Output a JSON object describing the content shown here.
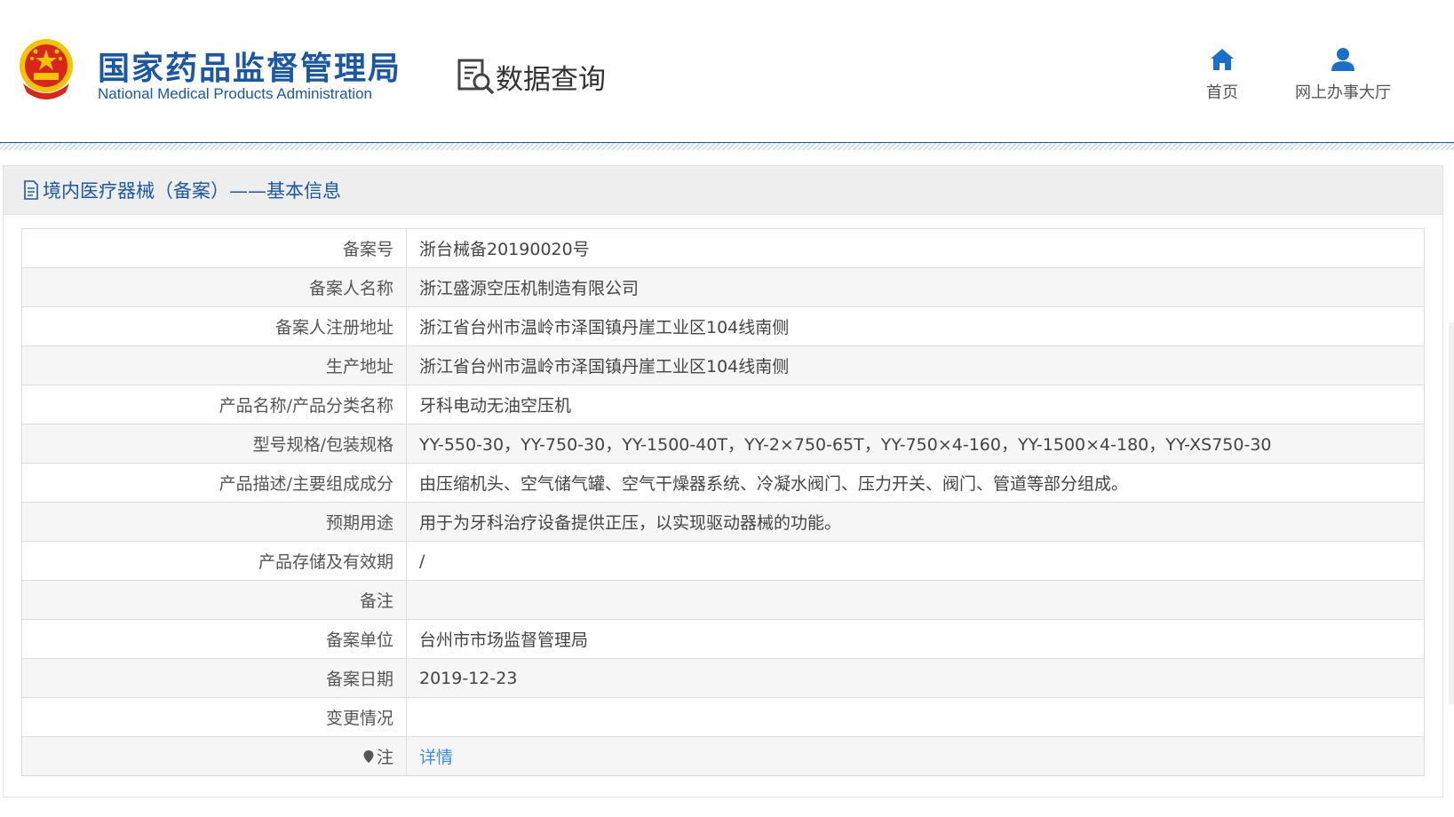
{
  "header": {
    "org_name_cn": "国家药品监督管理局",
    "org_name_en": "National Medical Products Administration",
    "page_title": "数据查询",
    "nav": [
      {
        "label": "首页",
        "icon": "home-icon"
      },
      {
        "label": "网上办事大厅",
        "icon": "user-icon"
      }
    ]
  },
  "panel": {
    "title": "境内医疗器械（备案）——基本信息",
    "rows": [
      {
        "label": "备案号",
        "value": "浙台械备20190020号"
      },
      {
        "label": "备案人名称",
        "value": "浙江盛源空压机制造有限公司"
      },
      {
        "label": "备案人注册地址",
        "value": "浙江省台州市温岭市泽国镇丹崖工业区104线南侧"
      },
      {
        "label": "生产地址",
        "value": "浙江省台州市温岭市泽国镇丹崖工业区104线南侧"
      },
      {
        "label": "产品名称/产品分类名称",
        "value": "牙科电动无油空压机"
      },
      {
        "label": "型号规格/包装规格",
        "value": "YY-550-30，YY-750-30，YY-1500-40T，YY-2×750-65T，YY-750×4-160，YY-1500×4-180，YY-XS750-30"
      },
      {
        "label": "产品描述/主要组成成分",
        "value": "由压缩机头、空气储气罐、空气干燥器系统、冷凝水阀门、压力开关、阀门、管道等部分组成。"
      },
      {
        "label": "预期用途",
        "value": "用于为牙科治疗设备提供正压，以实现驱动器械的功能。"
      },
      {
        "label": "产品存储及有效期",
        "value": "/"
      },
      {
        "label": "备注",
        "value": ""
      },
      {
        "label": "备案单位",
        "value": "台州市市场监督管理局"
      },
      {
        "label": "备案日期",
        "value": "2019-12-23"
      },
      {
        "label": "变更情况",
        "value": ""
      }
    ],
    "note": {
      "label": "注",
      "link": "详情",
      "icon": "location-pin-icon"
    }
  },
  "colors": {
    "brand_blue": "#1a57a6",
    "link_blue": "#3a8ee6",
    "emblem_red": "#d9261c",
    "emblem_gold": "#f5c400"
  }
}
